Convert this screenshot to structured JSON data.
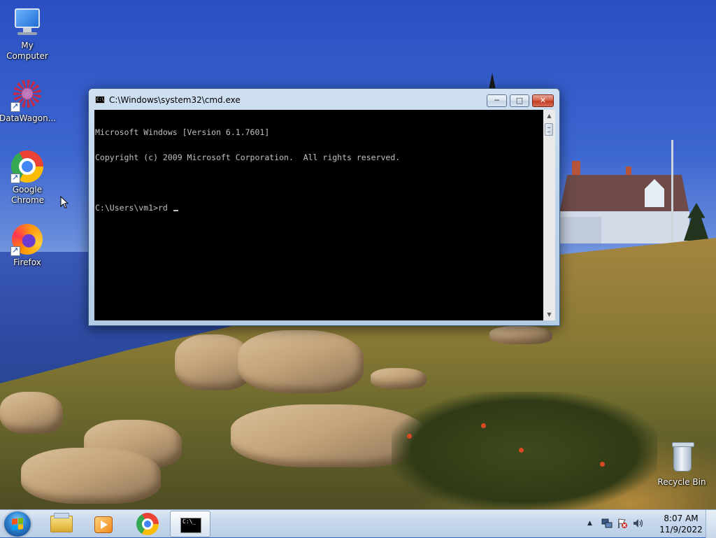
{
  "desktop": {
    "icons": {
      "my_computer": "My Computer",
      "datawagon": "DataWagon...",
      "chrome": "Google Chrome",
      "firefox": "Firefox",
      "recycle_bin": "Recycle Bin"
    }
  },
  "cmd_window": {
    "title": "C:\\Windows\\system32\\cmd.exe",
    "title_icon_text": "C:\\",
    "buttons": {
      "minimize": "─",
      "maximize": "□",
      "close": "✕"
    },
    "lines": [
      "Microsoft Windows [Version 6.1.7601]",
      "Copyright (c) 2009 Microsoft Corporation.  All rights reserved.",
      "",
      "C:\\Users\\vm1>rd "
    ],
    "scroll_up": "▲",
    "scroll_down": "▼"
  },
  "taskbar": {
    "pinned": [
      {
        "name": "start",
        "icon": "windows-logo-icon"
      },
      {
        "name": "explorer",
        "icon": "folder-icon"
      },
      {
        "name": "media-player",
        "icon": "media-player-icon"
      },
      {
        "name": "chrome",
        "icon": "chrome-icon"
      },
      {
        "name": "cmd",
        "icon": "cmd-icon",
        "active": true
      }
    ],
    "cmd_icon_text": "C:\\_",
    "tray": {
      "show_hidden": "▲",
      "network_icon": "network-icon",
      "action_center_icon": "flag-x-icon",
      "volume_icon": "volume-icon"
    },
    "clock": {
      "time": "8:07 AM",
      "date": "11/9/2022"
    }
  },
  "colors": {
    "console_bg": "#000000",
    "console_text": "#c0c0c0",
    "close_button": "#c23c23",
    "taskbar": "#c9daee"
  }
}
